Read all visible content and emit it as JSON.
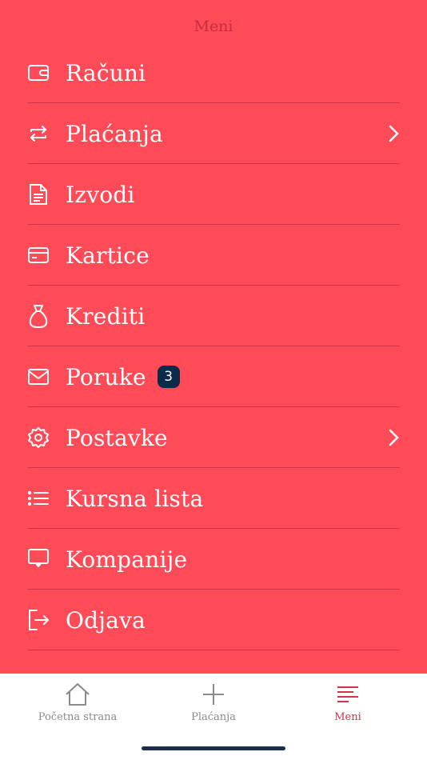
{
  "header": {
    "title": "Meni"
  },
  "menu": {
    "items": [
      {
        "label": "Računi",
        "icon": "wallet-icon"
      },
      {
        "label": "Plaćanja",
        "icon": "transfer-arrows-icon",
        "has_chevron": true
      },
      {
        "label": "Izvodi",
        "icon": "document-icon"
      },
      {
        "label": "Kartice",
        "icon": "card-icon"
      },
      {
        "label": "Krediti",
        "icon": "money-bag-icon"
      },
      {
        "label": "Poruke",
        "icon": "envelope-icon",
        "badge": "3"
      },
      {
        "label": "Postavke",
        "icon": "gear-icon",
        "has_chevron": true
      },
      {
        "label": "Kursna lista",
        "icon": "list-icon"
      },
      {
        "label": "Kompanije",
        "icon": "chat-screen-icon"
      },
      {
        "label": "Odjava",
        "icon": "logout-icon"
      }
    ]
  },
  "bottom_nav": {
    "home_label": "Početna strana",
    "payments_label": "Plaćanja",
    "menu_label": "Meni"
  },
  "colors": {
    "background": "#ff4a57",
    "badge": "#0c2a4a",
    "active_tab": "#d03448",
    "inactive_tab": "#8a8a8a"
  }
}
